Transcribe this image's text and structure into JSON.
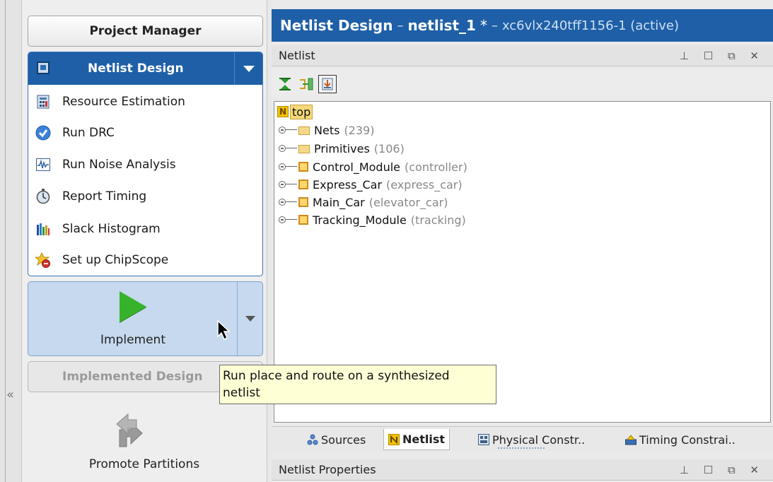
{
  "flow_navigator": {
    "project_manager": "Project Manager",
    "netlist_design": {
      "title": "Netlist Design",
      "items": [
        {
          "label": "Resource Estimation",
          "icon": "calculator-icon"
        },
        {
          "label": "Run DRC",
          "icon": "check-circle-icon"
        },
        {
          "label": "Run Noise Analysis",
          "icon": "waveform-icon"
        },
        {
          "label": "Report Timing",
          "icon": "stopwatch-icon"
        },
        {
          "label": "Slack Histogram",
          "icon": "histogram-icon"
        },
        {
          "label": "Set up ChipScope",
          "icon": "chipscope-icon"
        }
      ]
    },
    "implement": "Implement",
    "implemented_design": "Implemented Design",
    "promote_partitions": "Promote Partitions"
  },
  "title_bar": {
    "view": "Netlist Design",
    "dash1": "–",
    "design": "netlist_1",
    "modified": "*",
    "dash2": "–",
    "part": "xc6vlx240tff1156-1 (active)"
  },
  "netlist_panel": {
    "title": "Netlist",
    "window_controls": "⊥ ☐ ⧉ ✕",
    "root": "top",
    "tree": [
      {
        "name": "Nets",
        "detail": "(239)",
        "kind": "folder"
      },
      {
        "name": "Primitives",
        "detail": "(106)",
        "kind": "folder"
      },
      {
        "name": "Control_Module",
        "detail": "(controller)",
        "kind": "cell"
      },
      {
        "name": "Express_Car",
        "detail": "(express_car)",
        "kind": "cell"
      },
      {
        "name": "Main_Car",
        "detail": "(elevator_car)",
        "kind": "cell"
      },
      {
        "name": "Tracking_Module",
        "detail": "(tracking)",
        "kind": "cell"
      }
    ]
  },
  "tabs": [
    {
      "label": "Sources",
      "active": false
    },
    {
      "label": "Netlist",
      "active": true
    },
    {
      "label": "Physical Constr..",
      "active": false
    },
    {
      "label": "Timing Constrai..",
      "active": false
    }
  ],
  "properties_panel": {
    "title": "Netlist Properties",
    "window_controls": "⊥ ☐ ⧉ ✕"
  },
  "tooltip": {
    "line1": "Run place and route on a synthesized",
    "line2": "netlist"
  },
  "colors": {
    "header_blue": "#1e5fa7",
    "implement_bg": "#c6d9ee",
    "play_green": "#37b32b",
    "tooltip_bg": "#ffffd6"
  }
}
